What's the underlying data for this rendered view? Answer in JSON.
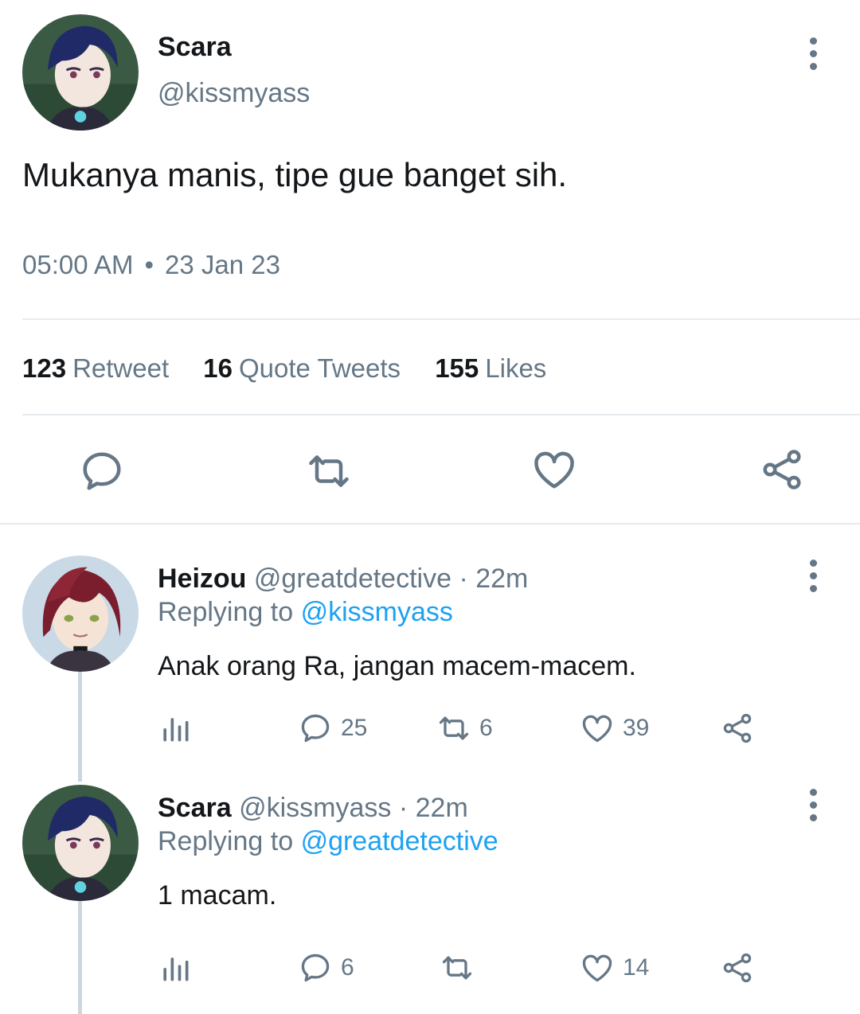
{
  "main_tweet": {
    "name": "Scara",
    "handle": "@kissmyass",
    "text": "Mukanya manis, tipe gue banget sih.",
    "time": "05:00 AM",
    "separator": "•",
    "date": "23 Jan 23",
    "stats": {
      "retweets_count": "123",
      "retweets_label": "Retweet",
      "quotes_count": "16",
      "quotes_label": "Quote Tweets",
      "likes_count": "155",
      "likes_label": "Likes"
    }
  },
  "replies": [
    {
      "name": "Heizou",
      "handle": "@greatdetective",
      "time_sep": "·",
      "time": "22m",
      "replying_prefix": "Replying to",
      "replying_to": "@kissmyass",
      "text": "Anak orang Ra, jangan macem-macem.",
      "reply_count": "25",
      "retweet_count": "6",
      "like_count": "39"
    },
    {
      "name": "Scara",
      "handle": "@kissmyass",
      "time_sep": "·",
      "time": "22m",
      "replying_prefix": "Replying to",
      "replying_to": "@greatdetective",
      "text": "1 macam.",
      "reply_count": "6",
      "retweet_count": "",
      "like_count": "14"
    }
  ],
  "colors": {
    "accent": "#1da1f2",
    "secondary_text": "#657786",
    "primary_text": "#14171a",
    "divider": "#e6ecf0"
  },
  "icons": [
    "more-icon",
    "reply-icon",
    "retweet-icon",
    "like-icon",
    "share-icon",
    "analytics-icon"
  ]
}
